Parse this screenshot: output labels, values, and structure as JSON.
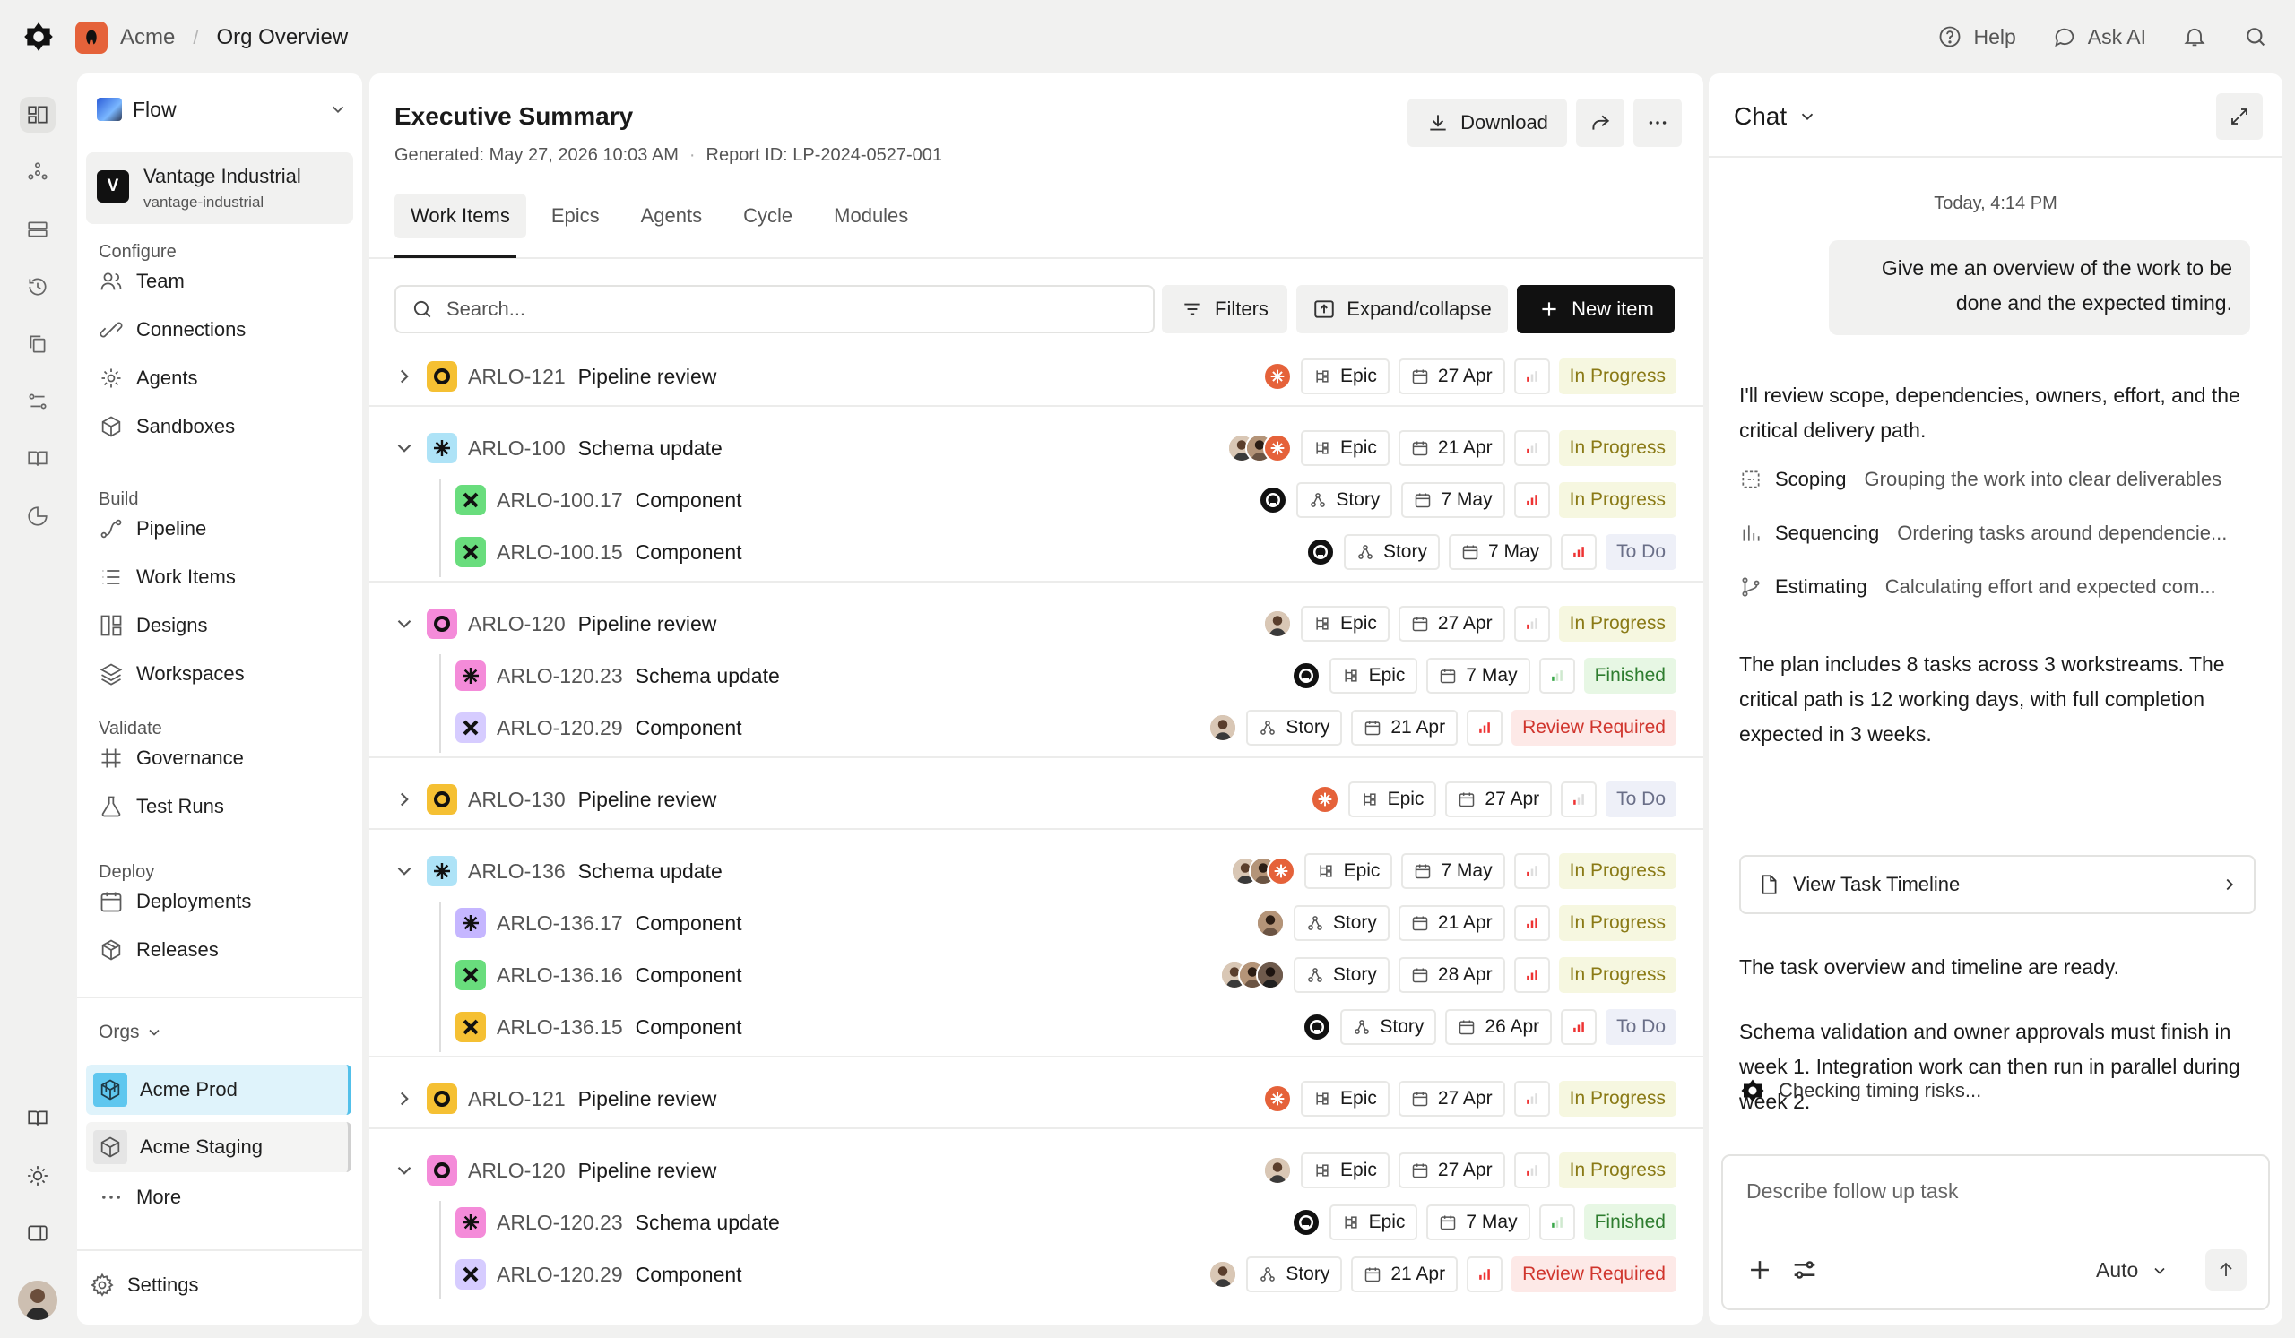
{
  "topbar": {
    "app_name": "Acme",
    "page_name": "Org Overview",
    "help_label": "Help",
    "ask_ai_label": "Ask AI"
  },
  "sidebar": {
    "workspace": "Flow",
    "org_name": "Vantage Industrial",
    "org_slug": "vantage-industrial",
    "org_initial": "V",
    "sections": {
      "configure": "Configure",
      "build": "Build",
      "validate": "Validate",
      "deploy": "Deploy"
    },
    "configure_items": [
      {
        "label": "Team",
        "icon": "team-icon"
      },
      {
        "label": "Connections",
        "icon": "connections-icon"
      },
      {
        "label": "Agents",
        "icon": "agents-icon"
      },
      {
        "label": "Sandboxes",
        "icon": "sandbox-icon"
      }
    ],
    "build_items": [
      {
        "label": "Pipeline",
        "icon": "pipeline-icon"
      },
      {
        "label": "Work Items",
        "icon": "list-icon"
      },
      {
        "label": "Designs",
        "icon": "designs-icon"
      },
      {
        "label": "Workspaces",
        "icon": "layers-icon"
      }
    ],
    "validate_items": [
      {
        "label": "Governance",
        "icon": "grid-icon"
      },
      {
        "label": "Test Runs",
        "icon": "flask-icon"
      }
    ],
    "deploy_items": [
      {
        "label": "Deployments",
        "icon": "calendar-icon"
      },
      {
        "label": "Releases",
        "icon": "package-icon"
      }
    ],
    "orgs_label": "Orgs",
    "orgs": [
      {
        "label": "Acme Prod",
        "selected": true
      },
      {
        "label": "Acme Staging",
        "selected": false
      }
    ],
    "more_label": "More",
    "settings_label": "Settings"
  },
  "main": {
    "title": "Executive Summary",
    "generated": "Generated: May 27, 2026 10:03 AM",
    "report_id": "Report ID: LP-2024-0527-001",
    "download_label": "Download",
    "tabs": [
      "Work Items",
      "Epics",
      "Agents",
      "Cycle",
      "Modules"
    ],
    "active_tab": "Work Items",
    "search_placeholder": "Search...",
    "filters_label": "Filters",
    "expand_label": "Expand/collapse",
    "new_item_label": "New item"
  },
  "rows": [
    {
      "id": "ARLO-121",
      "name": "Pipeline review",
      "level": "parent",
      "expanded": false,
      "icon": "ring",
      "assignees": [
        "claude"
      ],
      "type": "Epic",
      "date": "27 Apr",
      "priority": "low",
      "status": "In Progress"
    },
    {
      "id": "ARLO-100",
      "name": "Schema update",
      "level": "parent",
      "expanded": true,
      "icon": "burst",
      "assignees": [
        "p1",
        "p2",
        "claude"
      ],
      "type": "Epic",
      "date": "21 Apr",
      "priority": "low",
      "status": "In Progress"
    },
    {
      "id": "ARLO-100.17",
      "name": "Component",
      "level": "child",
      "icon": "xgreen",
      "assignees": [
        "gh"
      ],
      "type": "Story",
      "date": "7 May",
      "priority": "high",
      "status": "In Progress"
    },
    {
      "id": "ARLO-100.15",
      "name": "Component",
      "level": "child",
      "icon": "xgreen",
      "assignees": [
        "gh"
      ],
      "type": "Story",
      "date": "7 May",
      "priority": "high",
      "status": "To Do"
    },
    {
      "id": "ARLO-120",
      "name": "Pipeline review",
      "level": "parent",
      "expanded": true,
      "icon": "ringpink",
      "assignees": [
        "p1"
      ],
      "type": "Epic",
      "date": "27 Apr",
      "priority": "low",
      "status": "In Progress"
    },
    {
      "id": "ARLO-120.23",
      "name": "Schema update",
      "level": "child",
      "icon": "burstpink",
      "assignees": [
        "gh"
      ],
      "type": "Epic",
      "date": "7 May",
      "priority": "green",
      "status": "Finished"
    },
    {
      "id": "ARLO-120.29",
      "name": "Component",
      "level": "child",
      "icon": "xpurple",
      "assignees": [
        "p1"
      ],
      "type": "Story",
      "date": "21 Apr",
      "priority": "high",
      "status": "Review Required"
    },
    {
      "id": "ARLO-130",
      "name": "Pipeline review",
      "level": "parent",
      "expanded": false,
      "icon": "ring",
      "assignees": [
        "claude"
      ],
      "type": "Epic",
      "date": "27 Apr",
      "priority": "low",
      "status": "To Do"
    },
    {
      "id": "ARLO-136",
      "name": "Schema update",
      "level": "parent",
      "expanded": true,
      "icon": "burst",
      "assignees": [
        "p1",
        "p2",
        "claude"
      ],
      "type": "Epic",
      "date": "7 May",
      "priority": "low",
      "status": "In Progress"
    },
    {
      "id": "ARLO-136.17",
      "name": "Component",
      "level": "child",
      "icon": "burstpurple",
      "assignees": [
        "p2"
      ],
      "type": "Story",
      "date": "21 Apr",
      "priority": "high",
      "status": "In Progress"
    },
    {
      "id": "ARLO-136.16",
      "name": "Component",
      "level": "child",
      "icon": "xgreen",
      "assignees": [
        "p1",
        "p2",
        "p3"
      ],
      "type": "Story",
      "date": "28 Apr",
      "priority": "high",
      "status": "In Progress"
    },
    {
      "id": "ARLO-136.15",
      "name": "Component",
      "level": "child",
      "icon": "xyellow",
      "assignees": [
        "gh"
      ],
      "type": "Story",
      "date": "26 Apr",
      "priority": "high",
      "status": "To Do"
    },
    {
      "id": "ARLO-121",
      "name": "Pipeline review",
      "level": "parent",
      "expanded": false,
      "icon": "ring",
      "assignees": [
        "claude"
      ],
      "type": "Epic",
      "date": "27 Apr",
      "priority": "low",
      "status": "In Progress"
    },
    {
      "id": "ARLO-120",
      "name": "Pipeline review",
      "level": "parent",
      "expanded": true,
      "icon": "ringpink",
      "assignees": [
        "p1"
      ],
      "type": "Epic",
      "date": "27 Apr",
      "priority": "low",
      "status": "In Progress"
    },
    {
      "id": "ARLO-120.23",
      "name": "Schema update",
      "level": "child",
      "icon": "burstpink",
      "assignees": [
        "gh"
      ],
      "type": "Epic",
      "date": "7 May",
      "priority": "green",
      "status": "Finished"
    },
    {
      "id": "ARLO-120.29",
      "name": "Component",
      "level": "child",
      "icon": "xpurple",
      "assignees": [
        "p1"
      ],
      "type": "Story",
      "date": "21 Apr",
      "priority": "high",
      "status": "Review Required"
    }
  ],
  "chat": {
    "title": "Chat",
    "timestamp": "Today, 4:14 PM",
    "user_message": "Give me an overview of the work to be done and the expected timing.",
    "ai_intro": "I'll review scope, dependencies, owners, effort, and the critical delivery path.",
    "steps": [
      {
        "name": "Scoping",
        "desc": "Grouping the work into clear deliverables"
      },
      {
        "name": "Sequencing",
        "desc": "Ordering tasks around dependencie..."
      },
      {
        "name": "Estimating",
        "desc": "Calculating effort and expected com..."
      }
    ],
    "ai_plan": "The plan includes 8 tasks across 3 workstreams. The critical path is 12 working days, with full completion expected in 3 weeks.",
    "timeline_label": "View Task Timeline",
    "ai_ready": "The task overview and timeline are ready.",
    "ai_schema": "Schema validation and owner approvals must finish in week 1. Integration work can then run in parallel during week 2.",
    "checking": "Checking timing risks...",
    "composer_placeholder": "Describe follow up task",
    "mode": "Auto"
  },
  "colors": {
    "accent": "#e5623a",
    "in_progress_bg": "#f6f7e0",
    "finished_bg": "#e7f7e4",
    "review_bg": "#fde9e7",
    "todo_bg": "#eef0f8",
    "org_selected": "#5fc7ef"
  }
}
